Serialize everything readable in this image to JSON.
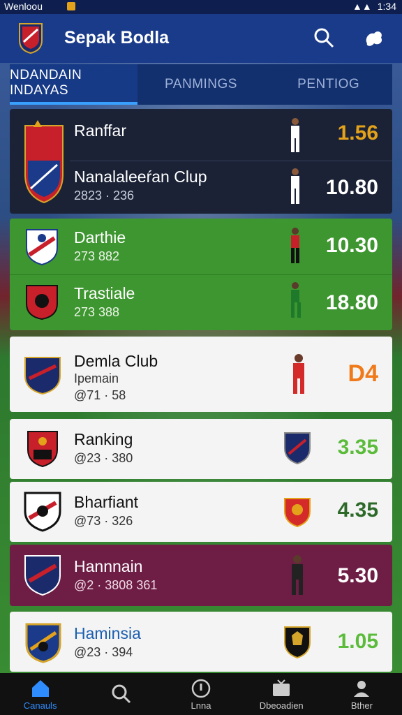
{
  "status_bar": {
    "left": "Wenloou",
    "right": "1:34"
  },
  "app": {
    "title": "Sepak Bodla"
  },
  "tabs": [
    {
      "label": "NDANDAIN INDAYAS",
      "active": true
    },
    {
      "label": "PANMINGS",
      "active": false
    },
    {
      "label": "PENTIOG",
      "active": false
    }
  ],
  "rows": [
    {
      "name": "Ranffar",
      "value": "1.56",
      "value_color": "#e3a21a"
    },
    {
      "name": "Nanalaleeŕan Clup",
      "sub": "2823 · 236",
      "value": "10.80",
      "value_color": "#ffffff"
    },
    {
      "name": "Darthie",
      "sub": "273 882",
      "value": "10.30",
      "value_color": "#ffffff"
    },
    {
      "name": "Trastiale",
      "sub": "273 388",
      "value": "18.80",
      "value_color": "#ffffff"
    },
    {
      "name": "Demla Club",
      "sub2": "Ipemain",
      "sub": "@71 · 58",
      "value": "D4",
      "value_color": "#f07a1a"
    },
    {
      "name": "Ranking",
      "sub": "@23 · 380",
      "value": "3.35",
      "value_color": "#5bbb3a"
    },
    {
      "name": "Bharfiant",
      "sub": "@73 · 326",
      "value": "4.35",
      "value_color": "#2d6a2a"
    },
    {
      "name": "Hannnain",
      "sub": "@2 · 3808 361",
      "value": "5.30",
      "value_color": "#ffffff"
    },
    {
      "name": "Haminsia",
      "sub": "@23 · 394",
      "value": "1.05",
      "value_color": "#5bbb3a"
    }
  ],
  "bottom_nav": [
    {
      "label": "Canauls",
      "icon": "home-icon",
      "active": true
    },
    {
      "label": "",
      "icon": "search-icon",
      "active": false
    },
    {
      "label": "Lnna",
      "icon": "info-icon",
      "active": false
    },
    {
      "label": "Dbeoadien",
      "icon": "tv-icon",
      "active": false
    },
    {
      "label": "Bther",
      "icon": "user-icon",
      "active": false
    }
  ]
}
